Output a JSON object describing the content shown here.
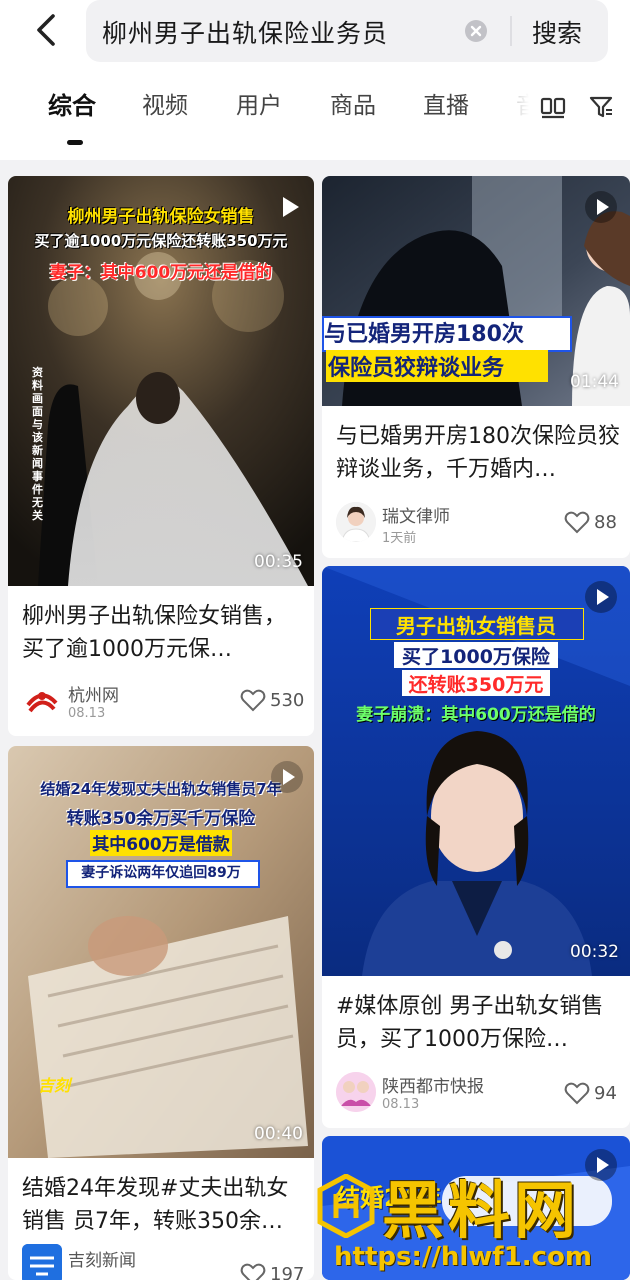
{
  "search": {
    "query": "柳州男子出轨保险业务员",
    "button_label": "搜索"
  },
  "tabs": [
    {
      "label": "综合",
      "active": true
    },
    {
      "label": "视频"
    },
    {
      "label": "用户"
    },
    {
      "label": "商品"
    },
    {
      "label": "直播"
    },
    {
      "label": "音"
    }
  ],
  "icons": {
    "back": "back-arrow-icon",
    "clear": "clear-icon",
    "layout": "double-column-layout-icon",
    "filter": "filter-icon",
    "play": "play-icon",
    "like": "heart-outline-icon"
  },
  "colors": {
    "overlay_yellow": "#ffe100",
    "overlay_red": "#ff2a2a",
    "overlay_white": "#ffffff",
    "overlay_green": "#6dff6b",
    "overlay_navy": "#13247a",
    "accent_blue": "#1e54e8"
  },
  "cards": [
    {
      "title": "柳州男子出轨保险女销售，买了逾1000万元保…",
      "duration": "00:35",
      "author": "杭州网",
      "date": "08.13",
      "likes": "530",
      "overlay": [
        "柳州男子出轨保险女销售",
        "买了逾1000万元保险还转账350万元",
        "妻子：其中600万元还是借的"
      ],
      "side_note": "资料画面与该新闻事件无关"
    },
    {
      "title": "与已婚男开房180次保险员狡辩谈业务，千万婚内…",
      "duration": "01:44",
      "author": "瑞文律师",
      "date": "1天前",
      "likes": "88",
      "overlay": [
        "与已婚男开房180次",
        "保险员狡辩谈业务"
      ]
    },
    {
      "title": "#媒体原创 男子出轨女销售员，买了1000万保险…",
      "duration": "00:32",
      "author": "陕西都市快报",
      "date": "08.13",
      "likes": "94",
      "overlay": [
        "男子出轨女销售员",
        "买了1000万保险",
        "还转账350万元",
        "妻子崩溃：其中600万还是借的"
      ]
    },
    {
      "title": "结婚24年发现#丈夫出轨女销售 员7年，转账350余…",
      "duration": "00:40",
      "author": "吉刻新闻",
      "likes": "197",
      "overlay": [
        "结婚24年发现丈夫出轨女销售员7年",
        "转账350余万买千万保险",
        "其中600万是借款",
        "妻子诉讼两年仅追回89万"
      ],
      "logo_text": "吉刻"
    },
    {
      "overlay": [
        "结婚24年"
      ]
    }
  ],
  "watermark": {
    "name": "黑料网",
    "url": "https://hlwf1.com"
  }
}
